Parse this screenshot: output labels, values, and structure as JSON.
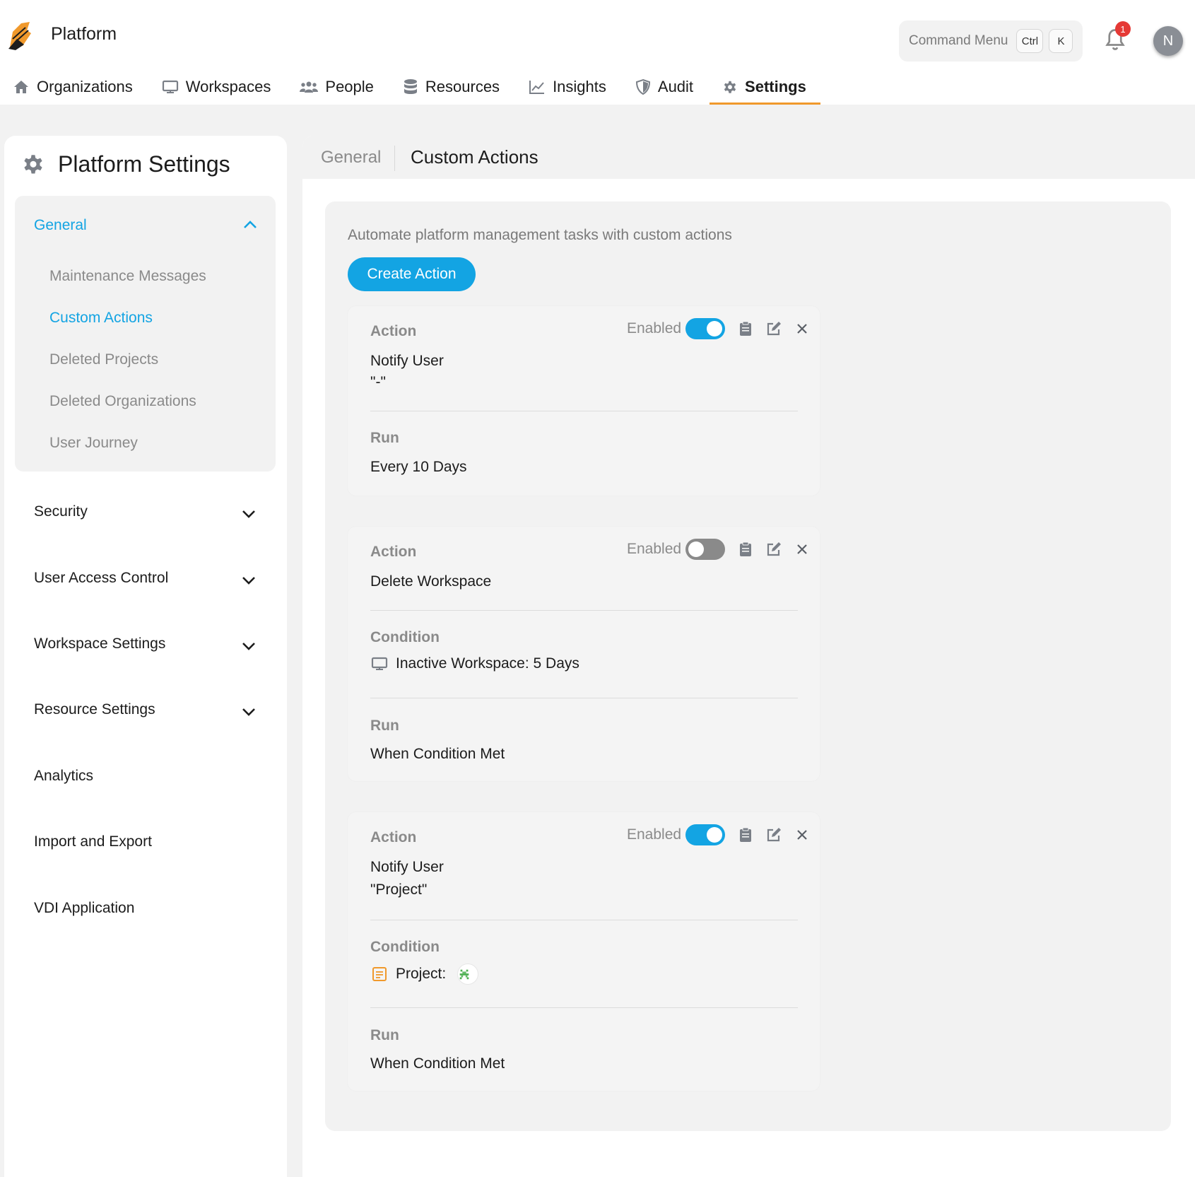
{
  "app": {
    "title": "Platform"
  },
  "header": {
    "command_menu": {
      "label": "Command Menu",
      "keys": [
        "Ctrl",
        "K"
      ]
    },
    "notifications": {
      "count": "1",
      "icon": "bell-icon"
    },
    "avatar": {
      "initial": "N"
    }
  },
  "nav": {
    "items": [
      {
        "label": "Organizations",
        "icon": "home-icon"
      },
      {
        "label": "Workspaces",
        "icon": "monitor-icon"
      },
      {
        "label": "People",
        "icon": "people-icon"
      },
      {
        "label": "Resources",
        "icon": "database-icon"
      },
      {
        "label": "Insights",
        "icon": "chart-line-icon"
      },
      {
        "label": "Audit",
        "icon": "shield-icon"
      },
      {
        "label": "Settings",
        "icon": "gear-icon",
        "active": true
      }
    ]
  },
  "sidebar": {
    "title": "Platform Settings",
    "group": {
      "label": "General",
      "expanded": true,
      "items": [
        {
          "label": "Maintenance Messages"
        },
        {
          "label": "Custom Actions",
          "active": true
        },
        {
          "label": "Deleted Projects"
        },
        {
          "label": "Deleted Organizations"
        },
        {
          "label": "User Journey"
        }
      ]
    },
    "sections": [
      {
        "label": "Security",
        "expandable": true
      },
      {
        "label": "User Access Control",
        "expandable": true
      },
      {
        "label": "Workspace Settings",
        "expandable": true
      },
      {
        "label": "Resource Settings",
        "expandable": true
      },
      {
        "label": "Analytics",
        "expandable": false
      },
      {
        "label": "Import and Export",
        "expandable": false
      },
      {
        "label": "VDI Application",
        "expandable": false
      }
    ]
  },
  "main": {
    "tabs": {
      "general": "General",
      "current": "Custom Actions"
    },
    "description": "Automate platform management tasks with custom actions",
    "create_label": "Create Action",
    "labels": {
      "action": "Action",
      "condition": "Condition",
      "run": "Run",
      "enabled": "Enabled"
    },
    "cards": [
      {
        "enabled": true,
        "action": "Notify User",
        "action_detail": "\"-\"",
        "run": "Every 10 Days"
      },
      {
        "enabled": false,
        "action": "Delete Workspace",
        "condition": "Inactive Workspace: 5 Days",
        "condition_icon": "monitor-icon",
        "run": "When Condition Met"
      },
      {
        "enabled": true,
        "action": "Notify User",
        "action_detail": "\"Project\"",
        "condition": "Project:",
        "condition_icon": "project-icon",
        "run": "When Condition Met"
      }
    ]
  },
  "colors": {
    "accent": "#13a4e3",
    "active_tab_underline": "#f0992c",
    "badge": "#e53935",
    "muted_text": "#8a8a8a",
    "panel_bg": "#f2f2f2"
  }
}
